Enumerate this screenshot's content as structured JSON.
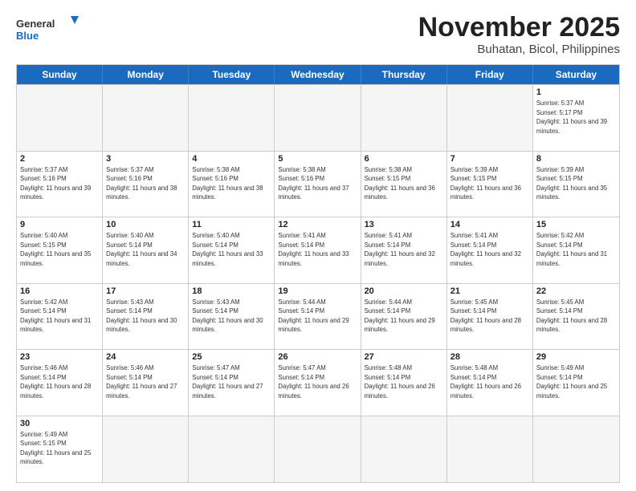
{
  "logo": {
    "general": "General",
    "blue": "Blue"
  },
  "title": "November 2025",
  "location": "Buhatan, Bicol, Philippines",
  "days": [
    "Sunday",
    "Monday",
    "Tuesday",
    "Wednesday",
    "Thursday",
    "Friday",
    "Saturday"
  ],
  "weeks": [
    [
      {
        "day": "",
        "empty": true
      },
      {
        "day": "",
        "empty": true
      },
      {
        "day": "",
        "empty": true
      },
      {
        "day": "",
        "empty": true
      },
      {
        "day": "",
        "empty": true
      },
      {
        "day": "",
        "empty": true
      },
      {
        "day": "1",
        "sunrise": "5:37 AM",
        "sunset": "5:17 PM",
        "daylight": "11 hours and 39 minutes."
      }
    ],
    [
      {
        "day": "2",
        "sunrise": "5:37 AM",
        "sunset": "5:16 PM",
        "daylight": "11 hours and 39 minutes."
      },
      {
        "day": "3",
        "sunrise": "5:37 AM",
        "sunset": "5:16 PM",
        "daylight": "11 hours and 38 minutes."
      },
      {
        "day": "4",
        "sunrise": "5:38 AM",
        "sunset": "5:16 PM",
        "daylight": "11 hours and 38 minutes."
      },
      {
        "day": "5",
        "sunrise": "5:38 AM",
        "sunset": "5:16 PM",
        "daylight": "11 hours and 37 minutes."
      },
      {
        "day": "6",
        "sunrise": "5:38 AM",
        "sunset": "5:15 PM",
        "daylight": "11 hours and 36 minutes."
      },
      {
        "day": "7",
        "sunrise": "5:39 AM",
        "sunset": "5:15 PM",
        "daylight": "11 hours and 36 minutes."
      },
      {
        "day": "8",
        "sunrise": "5:39 AM",
        "sunset": "5:15 PM",
        "daylight": "11 hours and 35 minutes."
      }
    ],
    [
      {
        "day": "9",
        "sunrise": "5:40 AM",
        "sunset": "5:15 PM",
        "daylight": "11 hours and 35 minutes."
      },
      {
        "day": "10",
        "sunrise": "5:40 AM",
        "sunset": "5:14 PM",
        "daylight": "11 hours and 34 minutes."
      },
      {
        "day": "11",
        "sunrise": "5:40 AM",
        "sunset": "5:14 PM",
        "daylight": "11 hours and 33 minutes."
      },
      {
        "day": "12",
        "sunrise": "5:41 AM",
        "sunset": "5:14 PM",
        "daylight": "11 hours and 33 minutes."
      },
      {
        "day": "13",
        "sunrise": "5:41 AM",
        "sunset": "5:14 PM",
        "daylight": "11 hours and 32 minutes."
      },
      {
        "day": "14",
        "sunrise": "5:41 AM",
        "sunset": "5:14 PM",
        "daylight": "11 hours and 32 minutes."
      },
      {
        "day": "15",
        "sunrise": "5:42 AM",
        "sunset": "5:14 PM",
        "daylight": "11 hours and 31 minutes."
      }
    ],
    [
      {
        "day": "16",
        "sunrise": "5:42 AM",
        "sunset": "5:14 PM",
        "daylight": "11 hours and 31 minutes."
      },
      {
        "day": "17",
        "sunrise": "5:43 AM",
        "sunset": "5:14 PM",
        "daylight": "11 hours and 30 minutes."
      },
      {
        "day": "18",
        "sunrise": "5:43 AM",
        "sunset": "5:14 PM",
        "daylight": "11 hours and 30 minutes."
      },
      {
        "day": "19",
        "sunrise": "5:44 AM",
        "sunset": "5:14 PM",
        "daylight": "11 hours and 29 minutes."
      },
      {
        "day": "20",
        "sunrise": "5:44 AM",
        "sunset": "5:14 PM",
        "daylight": "11 hours and 29 minutes."
      },
      {
        "day": "21",
        "sunrise": "5:45 AM",
        "sunset": "5:14 PM",
        "daylight": "11 hours and 28 minutes."
      },
      {
        "day": "22",
        "sunrise": "5:45 AM",
        "sunset": "5:14 PM",
        "daylight": "11 hours and 28 minutes."
      }
    ],
    [
      {
        "day": "23",
        "sunrise": "5:46 AM",
        "sunset": "5:14 PM",
        "daylight": "11 hours and 28 minutes."
      },
      {
        "day": "24",
        "sunrise": "5:46 AM",
        "sunset": "5:14 PM",
        "daylight": "11 hours and 27 minutes."
      },
      {
        "day": "25",
        "sunrise": "5:47 AM",
        "sunset": "5:14 PM",
        "daylight": "11 hours and 27 minutes."
      },
      {
        "day": "26",
        "sunrise": "5:47 AM",
        "sunset": "5:14 PM",
        "daylight": "11 hours and 26 minutes."
      },
      {
        "day": "27",
        "sunrise": "5:48 AM",
        "sunset": "5:14 PM",
        "daylight": "11 hours and 26 minutes."
      },
      {
        "day": "28",
        "sunrise": "5:48 AM",
        "sunset": "5:14 PM",
        "daylight": "11 hours and 26 minutes."
      },
      {
        "day": "29",
        "sunrise": "5:49 AM",
        "sunset": "5:14 PM",
        "daylight": "11 hours and 25 minutes."
      }
    ],
    [
      {
        "day": "30",
        "sunrise": "5:49 AM",
        "sunset": "5:15 PM",
        "daylight": "11 hours and 25 minutes."
      },
      {
        "day": "",
        "empty": true
      },
      {
        "day": "",
        "empty": true
      },
      {
        "day": "",
        "empty": true
      },
      {
        "day": "",
        "empty": true
      },
      {
        "day": "",
        "empty": true
      },
      {
        "day": "",
        "empty": true
      }
    ]
  ]
}
